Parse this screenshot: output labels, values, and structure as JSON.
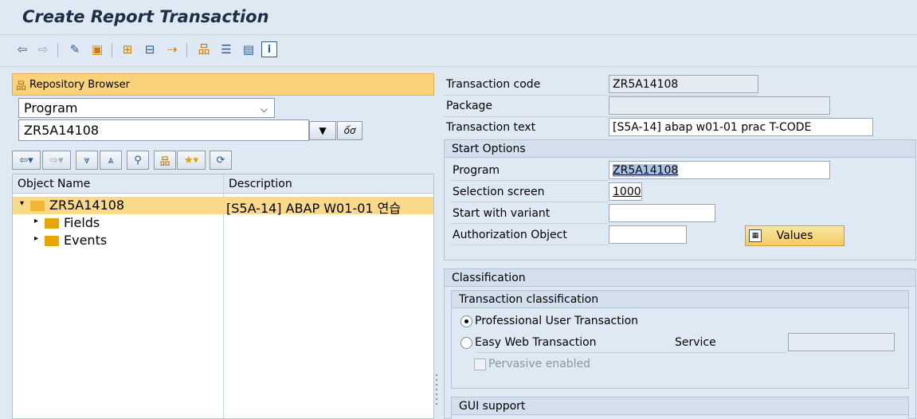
{
  "window": {
    "title": "Create Report Transaction"
  },
  "toolbar": {
    "icons": [
      "back-arrow-icon",
      "forward-arrow-icon",
      "display-change-icon",
      "activate-icon",
      "where-used-icon",
      "hierarchy-icon",
      "navigate-icon",
      "structure-icon",
      "other-object-icon",
      "layout-icon",
      "info-icon"
    ]
  },
  "repository_browser": {
    "label": "Repository Browser",
    "object_type": "Program",
    "object_name": "ZR5A14108"
  },
  "object_tree": {
    "columns": [
      "Object Name",
      "Description"
    ],
    "rows": [
      {
        "name": "ZR5A14108",
        "description": "[S5A-14] ABAP W01-01 연습",
        "expanded": true,
        "selected": true
      },
      {
        "name": "Fields",
        "description": "",
        "expanded": false,
        "selected": false
      },
      {
        "name": "Events",
        "description": "",
        "expanded": false,
        "selected": false
      }
    ]
  },
  "transaction": {
    "code_label": "Transaction code",
    "code_value": "ZR5A14108",
    "package_label": "Package",
    "package_value": "",
    "text_label": "Transaction text",
    "text_value": "[S5A-14] abap w01-01 prac T-CODE"
  },
  "start_options": {
    "title": "Start Options",
    "program_label": "Program",
    "program_value": "ZR5A14108",
    "selection_screen_label": "Selection screen",
    "selection_screen_value": "1000",
    "variant_label": "Start with variant",
    "variant_value": "",
    "auth_label": "Authorization Object",
    "auth_value": "",
    "values_button": "Values"
  },
  "classification": {
    "title": "Classification",
    "transaction_classification_title": "Transaction classification",
    "professional_label": "Professional User Transaction",
    "professional_selected": true,
    "easy_web_label": "Easy Web Transaction",
    "easy_web_selected": false,
    "service_label": "Service",
    "service_value": "",
    "pervasive_label": "Pervasive enabled",
    "pervasive_checked": false
  },
  "gui_support": {
    "title": "GUI support"
  }
}
